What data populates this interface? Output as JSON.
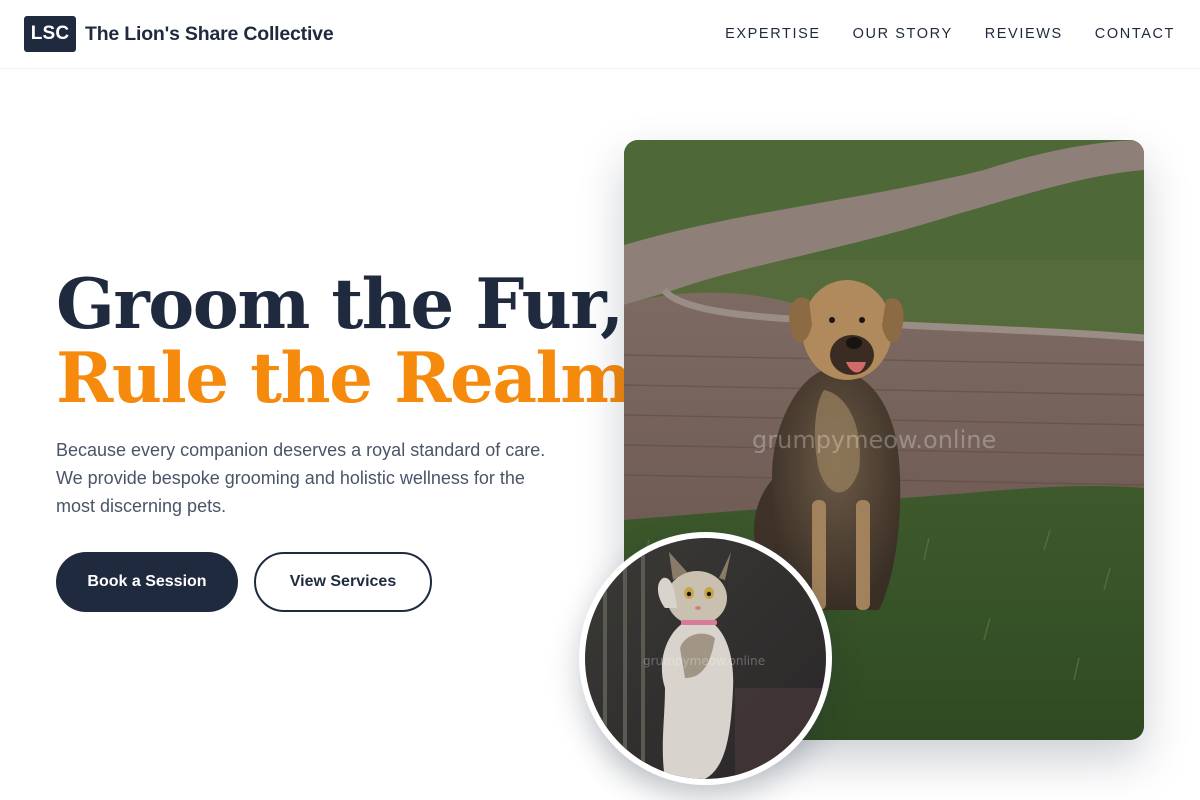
{
  "header": {
    "logo_text": "LSC",
    "brand_name": "The Lion's Share Collective",
    "nav": [
      "EXPERTISE",
      "OUR STORY",
      "REVIEWS",
      "CONTACT"
    ]
  },
  "hero": {
    "title_line1": "Groom the Fur,",
    "title_line2": "Rule the Realm.",
    "description": "Because every companion deserves a royal standard of care. We provide bespoke grooming and holistic wellness for the most discerning pets.",
    "primary_button": "Book a Session",
    "secondary_button": "View Services"
  },
  "images": {
    "main_photo": "dog-photo",
    "inset_photo": "cat-photo",
    "watermark": "grumpymeow.online"
  },
  "colors": {
    "navy": "#1f2a3f",
    "accent_orange": "#f68a0c",
    "body_text": "#4a5468"
  }
}
